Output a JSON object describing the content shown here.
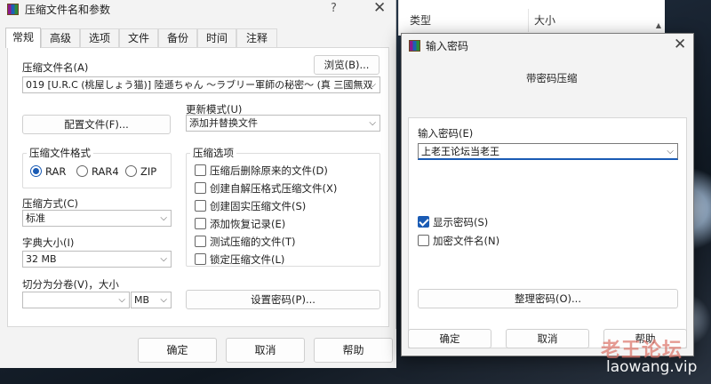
{
  "main_dialog": {
    "title": "压缩文件名和参数",
    "help_glyph": "?",
    "close_glyph": "✕",
    "tabs": [
      "常规",
      "高级",
      "选项",
      "文件",
      "备份",
      "时间",
      "注释"
    ],
    "archive_name_label": "压缩文件名(A)",
    "browse_button": "浏览(B)...",
    "archive_name_value": "019   [U.R.C (桃屋しょう猫)] 陸遜ちゃん ～ラブリー軍師の秘密～ (真 三國無双",
    "profiles_button": "配置文件(F)...",
    "update_mode_label": "更新模式(U)",
    "update_mode_value": "添加并替换文件",
    "format_label": "压缩文件格式",
    "formats": [
      "RAR",
      "RAR4",
      "ZIP"
    ],
    "format_selected": "RAR",
    "options_label": "压缩选项",
    "options": [
      {
        "label": "压缩后删除原来的文件(D)",
        "checked": false
      },
      {
        "label": "创建自解压格式压缩文件(X)",
        "checked": false
      },
      {
        "label": "创建固实压缩文件(S)",
        "checked": false
      },
      {
        "label": "添加恢复记录(E)",
        "checked": false
      },
      {
        "label": "测试压缩的文件(T)",
        "checked": false
      },
      {
        "label": "锁定压缩文件(L)",
        "checked": false
      }
    ],
    "method_label": "压缩方式(C)",
    "method_value": "标准",
    "dict_label": "字典大小(I)",
    "dict_value": "32 MB",
    "split_label": "切分为分卷(V)，大小",
    "split_value": "",
    "split_unit": "MB",
    "set_password_button": "设置密码(P)...",
    "ok_button": "确定",
    "cancel_button": "取消",
    "help_button": "帮助",
    "dropdown_arrow": "⌵"
  },
  "file_list": {
    "col_type": "类型",
    "col_size": "大小",
    "scroll_up": "▲"
  },
  "password_dialog": {
    "title": "输入密码",
    "close_glyph": "✕",
    "subtitle": "带密码压缩",
    "password_label": "输入密码(E)",
    "password_value": "上老王论坛当老王",
    "show_password": {
      "label": "显示密码(S)",
      "checked": true
    },
    "encrypt_names": {
      "label": "加密文件名(N)",
      "checked": false
    },
    "organize_button": "整理密码(O)...",
    "ok_button": "确定",
    "cancel_button": "取消",
    "help_button": "帮助"
  },
  "watermark": {
    "text": "老王论坛",
    "url": "laowang.vip"
  },
  "colors": {
    "accent": "#1a5bb4",
    "dialog_bg": "#f3f3f3",
    "pane_bg": "#ffffff"
  }
}
